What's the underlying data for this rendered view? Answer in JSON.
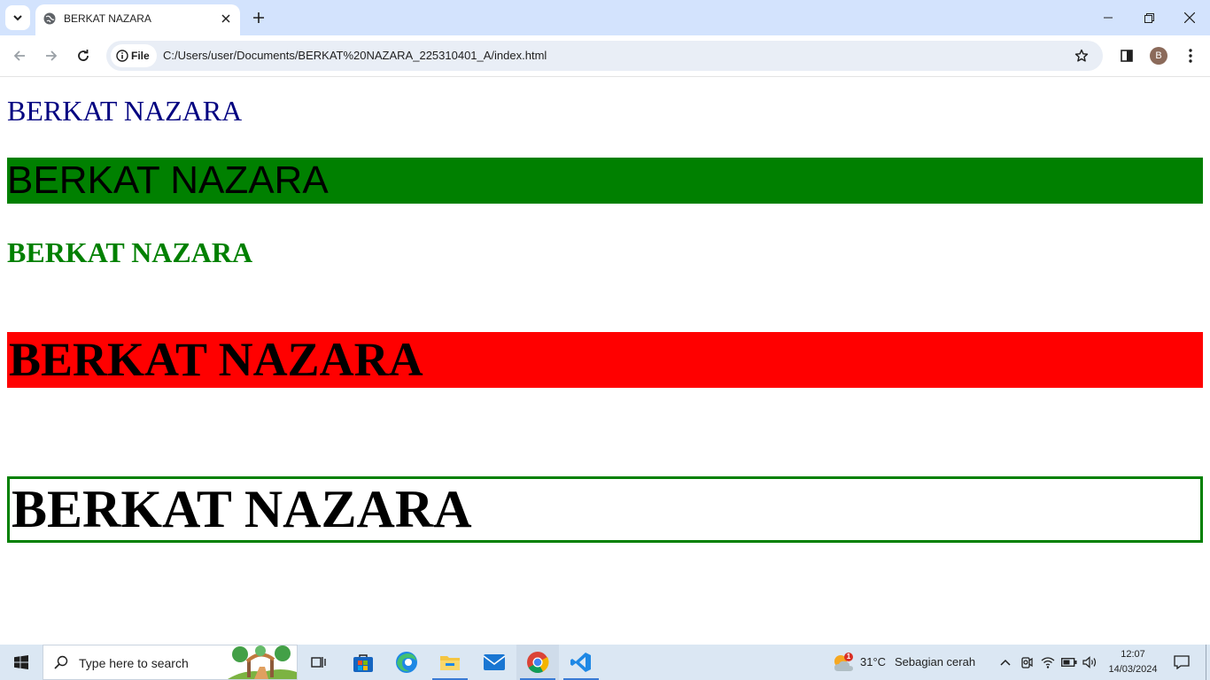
{
  "browser": {
    "tab_title": "BERKAT NAZARA",
    "chip_label": "File",
    "url": "C:/Users/user/Documents/BERKAT%20NAZARA_225310401_A/index.html",
    "profile_initial": "B"
  },
  "page": {
    "heading_1": "BERKAT NAZARA",
    "heading_2": "BERKAT NAZARA",
    "heading_3": "BERKAT NAZARA",
    "heading_4": "BERKAT NAZARA",
    "heading_5": "BERKAT NAZARA",
    "colors": {
      "navy_text": "#000080",
      "green": "#008000",
      "red": "#ff0000"
    }
  },
  "taskbar": {
    "search_placeholder": "Type here to search",
    "weather_temp": "31°C",
    "weather_desc": "Sebagian cerah",
    "weather_badge": "1",
    "time": "12:07",
    "date": "14/03/2024",
    "pinned_apps": [
      "task-view-icon",
      "store-icon",
      "edge-icon",
      "file-explorer-icon",
      "mail-icon",
      "chrome-icon",
      "vscode-icon"
    ]
  }
}
